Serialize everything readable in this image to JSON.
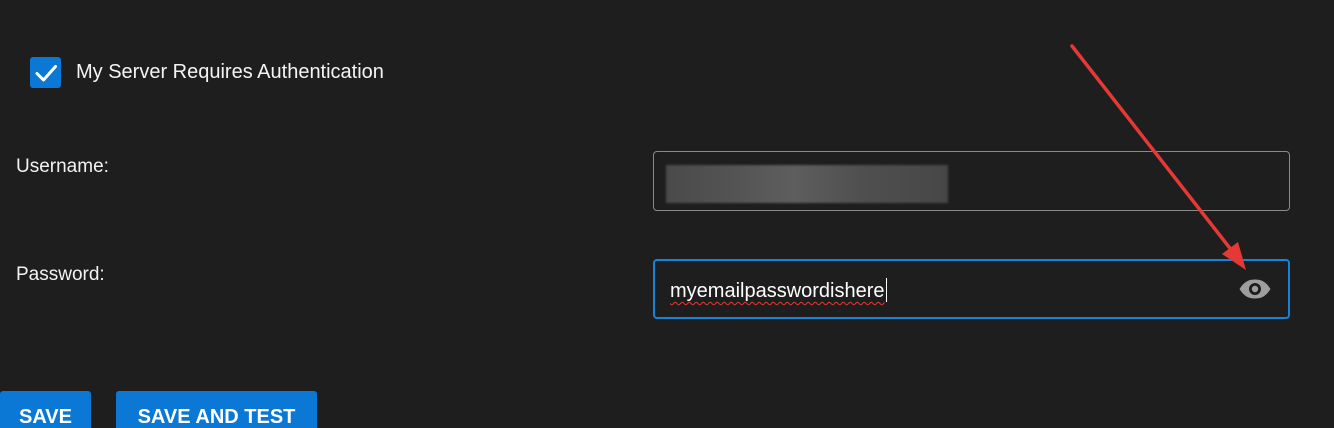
{
  "auth": {
    "checked": true,
    "label": "My Server Requires Authentication"
  },
  "username": {
    "label": "Username:"
  },
  "password": {
    "label": "Password:",
    "value": "myemailpasswordishere",
    "reveal_icon": "eye-icon"
  },
  "buttons": {
    "save_label": "SAVE",
    "save_test_label": "SAVE AND TEST"
  },
  "colors": {
    "background": "#1e1e1e",
    "accent": "#0a78d4",
    "focus_border": "#1583d8",
    "annotation_arrow": "#e53935"
  }
}
